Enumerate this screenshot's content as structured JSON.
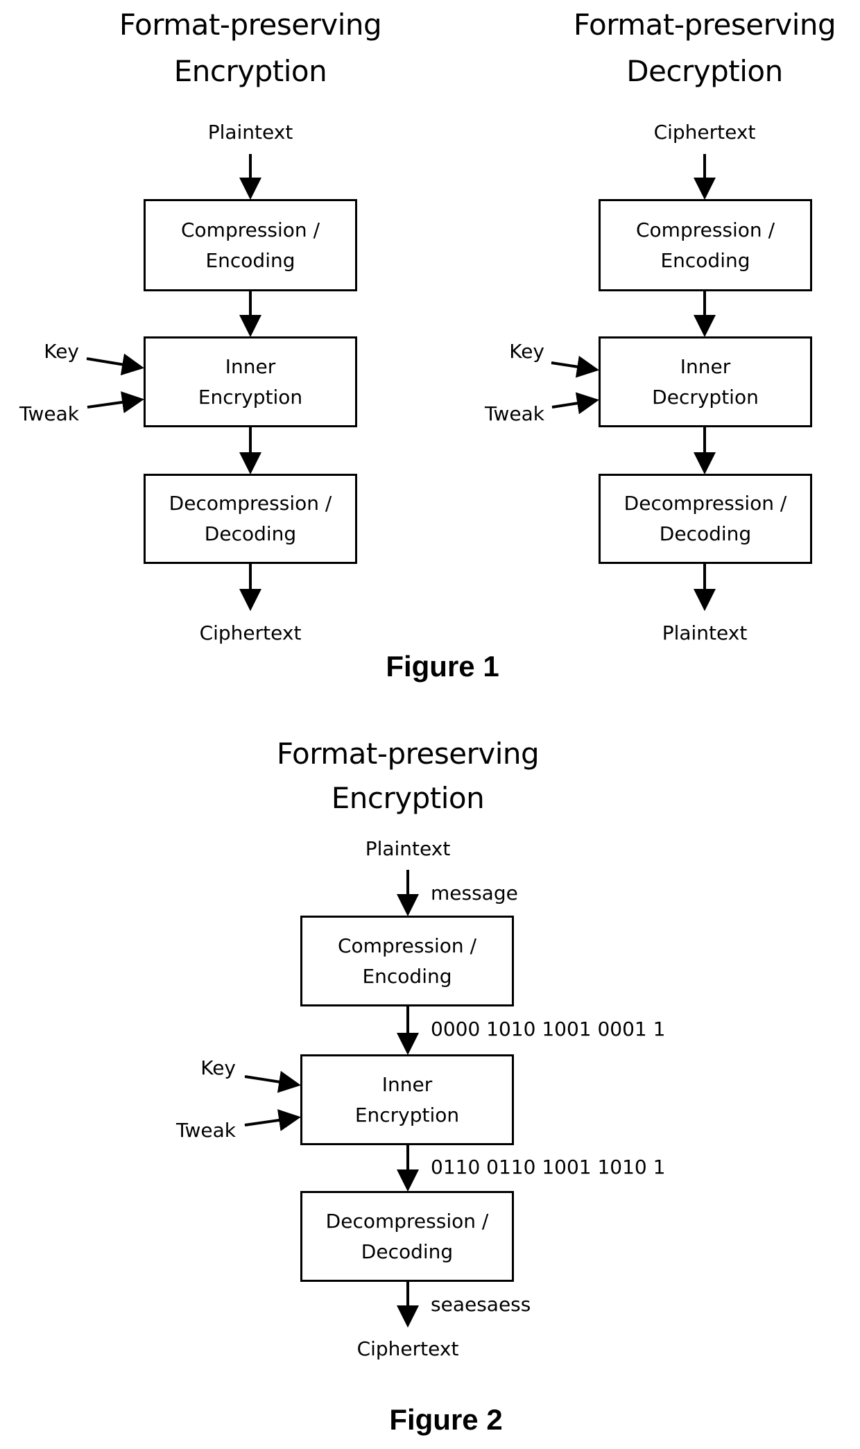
{
  "figure1": {
    "caption": "Figure 1",
    "encryption": {
      "title_line1": "Format-preserving",
      "title_line2": "Encryption",
      "input": "Plaintext",
      "output": "Ciphertext",
      "side_inputs": [
        "Key",
        "Tweak"
      ],
      "boxes": [
        {
          "line1": "Compression /",
          "line2": "Encoding"
        },
        {
          "line1": "Inner",
          "line2": "Encryption"
        },
        {
          "line1": "Decompression /",
          "line2": "Decoding"
        }
      ]
    },
    "decryption": {
      "title_line1": "Format-preserving",
      "title_line2": "Decryption",
      "input": "Ciphertext",
      "output": "Plaintext",
      "side_inputs": [
        "Key",
        "Tweak"
      ],
      "boxes": [
        {
          "line1": "Compression /",
          "line2": "Encoding"
        },
        {
          "line1": "Inner",
          "line2": "Decryption"
        },
        {
          "line1": "Decompression /",
          "line2": "Decoding"
        }
      ]
    }
  },
  "figure2": {
    "caption": "Figure 2",
    "title_line1": "Format-preserving",
    "title_line2": "Encryption",
    "input": "Plaintext",
    "output": "Ciphertext",
    "side_inputs": [
      "Key",
      "Tweak"
    ],
    "boxes": [
      {
        "line1": "Compression /",
        "line2": "Encoding"
      },
      {
        "line1": "Inner",
        "line2": "Encryption"
      },
      {
        "line1": "Decompression /",
        "line2": "Decoding"
      }
    ],
    "edge_values": [
      "message",
      "0000 1010 1001 0001 1",
      "0110 0110 1001 1010 1",
      "seaesaess"
    ]
  }
}
